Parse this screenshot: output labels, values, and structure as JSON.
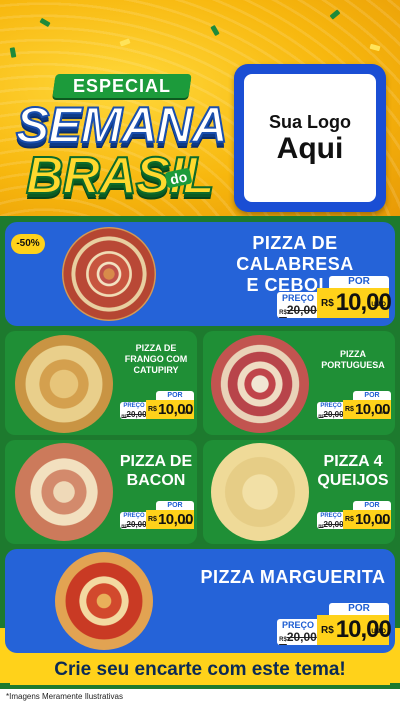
{
  "header": {
    "ribbon": "ESPECIAL",
    "title_line1": "SEMANA",
    "title_do": "do",
    "title_line2": "BRASIL",
    "logo_line1": "Sua Logo",
    "logo_line2": "Aqui"
  },
  "products": [
    {
      "name_lines": [
        "PIZZA DE CALABRESA",
        "E CEBOLA"
      ],
      "badge": "-50%",
      "preco_label": "PREÇO",
      "old_prefix": "R$",
      "old_price": "20,00",
      "por_label": "POR",
      "currency": "R$",
      "price": "10,00",
      "unit": "UNID"
    },
    {
      "name_lines": [
        "PIZZA DE",
        "FRANGO COM",
        "CATUPIRY"
      ],
      "preco_label": "PREÇO",
      "old_prefix": "R$",
      "old_price": "20,00",
      "por_label": "POR",
      "currency": "R$",
      "price": "10,00",
      "unit": "UNID"
    },
    {
      "name_lines": [
        "PIZZA",
        "PORTUGUESA"
      ],
      "preco_label": "PREÇO",
      "old_prefix": "R$",
      "old_price": "20,00",
      "por_label": "POR",
      "currency": "R$",
      "price": "10,00",
      "unit": "UNID"
    },
    {
      "name_lines": [
        "PIZZA DE",
        "BACON"
      ],
      "preco_label": "PREÇO",
      "old_prefix": "R$",
      "old_price": "20,00",
      "por_label": "POR",
      "currency": "R$",
      "price": "10,00",
      "unit": "UNID"
    },
    {
      "name_lines": [
        "PIZZA 4",
        "QUEIJOS"
      ],
      "preco_label": "PREÇO",
      "old_prefix": "R$",
      "old_price": "20,00",
      "por_label": "POR",
      "currency": "R$",
      "price": "10,00",
      "unit": "UNID"
    },
    {
      "name_lines": [
        "PIZZA MARGUERITA"
      ],
      "preco_label": "PREÇO",
      "old_prefix": "R$",
      "old_price": "20,00",
      "por_label": "POR",
      "currency": "R$",
      "price": "10,00",
      "unit": "UNID"
    }
  ],
  "footer": {
    "cta": "Crie seu encarte com este tema!",
    "note": "*Imagens Meramente Ilustrativas"
  },
  "colors": {
    "blue": "#2563d8",
    "green": "#1f8f36",
    "yellow": "#ffd21a"
  }
}
